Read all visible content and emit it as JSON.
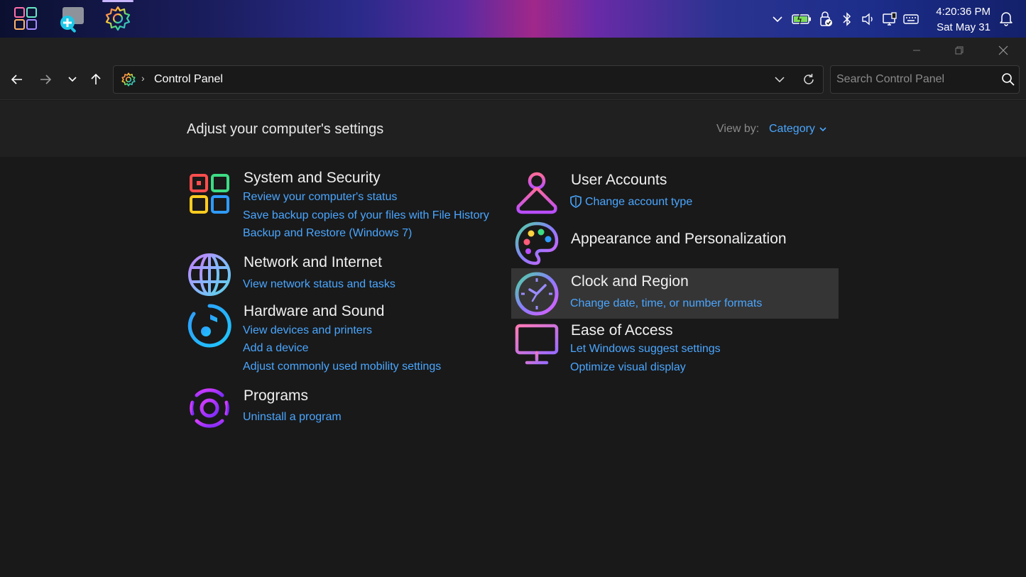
{
  "taskbar": {
    "apps": [
      {
        "name": "start-icon"
      },
      {
        "name": "magnifier-app-icon"
      },
      {
        "name": "settings-app-icon",
        "active": true
      }
    ],
    "tray_icons": [
      "chevron-up-icon",
      "battery-icon",
      "security-icon",
      "bluetooth-icon",
      "volume-icon",
      "display-icon",
      "keyboard-icon"
    ],
    "time": "4:20:36 PM",
    "date": "Sat May 31"
  },
  "address": {
    "location": "Control Panel",
    "search_placeholder": "Search Control Panel"
  },
  "header": {
    "title": "Adjust your computer's settings",
    "view_by_label": "View by:",
    "view_by_value": "Category"
  },
  "categories_left": [
    {
      "title": "System and Security",
      "icon": "system-security-icon",
      "links": [
        "Review your computer's status",
        "Save backup copies of your files with File History",
        "Backup and Restore (Windows 7)"
      ]
    },
    {
      "title": "Network and Internet",
      "icon": "globe-icon",
      "links": [
        "View network status and tasks"
      ]
    },
    {
      "title": "Hardware and Sound",
      "icon": "music-note-icon",
      "links": [
        "View devices and printers",
        "Add a device",
        "Adjust commonly used mobility settings"
      ]
    },
    {
      "title": "Programs",
      "icon": "programs-icon",
      "links": [
        "Uninstall a program"
      ]
    }
  ],
  "categories_right": [
    {
      "title": "User Accounts",
      "icon": "user-icon",
      "links": [
        "Change account type"
      ]
    },
    {
      "title": "Appearance and Personalization",
      "icon": "palette-icon",
      "links": []
    },
    {
      "title": "Clock and Region",
      "icon": "clock-icon",
      "links": [
        "Change date, time, or number formats"
      ],
      "hovered": true
    },
    {
      "title": "Ease of Access",
      "icon": "monitor-icon",
      "links": [
        "Let Windows suggest settings",
        "Optimize visual display"
      ]
    }
  ],
  "colors": {
    "link": "#4aa6ff",
    "background": "#191919",
    "band": "#202020"
  }
}
